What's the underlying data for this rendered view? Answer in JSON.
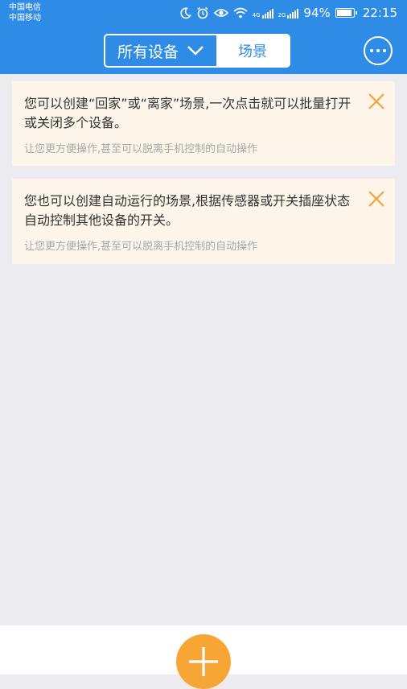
{
  "status_bar": {
    "carrier_1": "中国电信",
    "carrier_2": "中国移动",
    "icons": [
      "moon-icon",
      "alarm-icon",
      "eye-icon",
      "wifi-icon",
      "4g-signal-icon",
      "2g-signal-icon",
      "battery-icon"
    ],
    "net_4g": "4G",
    "net_2g": "2G",
    "battery": "94%",
    "battery_level": 0.94,
    "time": "22:15"
  },
  "header": {
    "segment_left_label": "所有设备",
    "segment_right_label": "场景",
    "colors": {
      "primary": "#2f8ce6",
      "text_on_primary": "#ffffff"
    }
  },
  "cards": [
    {
      "title": "您可以创建“回家”或“离家”场景,一次点击就可以批量打开或关闭多个设备。",
      "subtitle": "让您更方便操作,甚至可以脱离手机控制的自动操作"
    },
    {
      "title": "您也可以创建自动运行的场景,根据传感器或开关插座状态自动控制其他设备的开关。",
      "subtitle": "让您更方便操作,甚至可以脱离手机控制的自动操作"
    }
  ],
  "colors": {
    "card_bg": "#fdf5ea",
    "close_icon": "#f5a33b",
    "fab": "#f7a535",
    "page_bg": "#ebebf0"
  }
}
